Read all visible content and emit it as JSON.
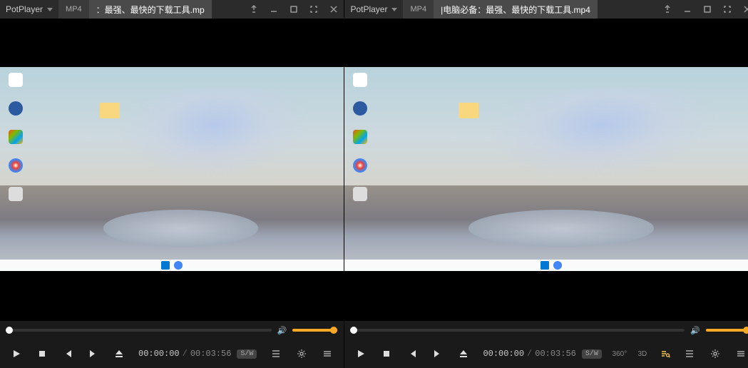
{
  "left": {
    "app_name": "PotPlayer",
    "format_tab": "MP4",
    "title": "：最强、最快的下载工具.mp",
    "time_current": "00:00:00",
    "time_duration": "00:03:56",
    "decoder": "S/W",
    "volume_percent": 90
  },
  "right": {
    "app_name": "PotPlayer",
    "format_tab": "MP4",
    "title": "|电脑必备：最强、最快的下载工具.mp4",
    "time_current": "00:00:00",
    "time_duration": "00:03:56",
    "decoder": "S/W",
    "extra_labels": {
      "deg360": "360°",
      "d3": "3D"
    },
    "volume_percent": 90
  },
  "colors": {
    "accent": "#f9a825"
  }
}
